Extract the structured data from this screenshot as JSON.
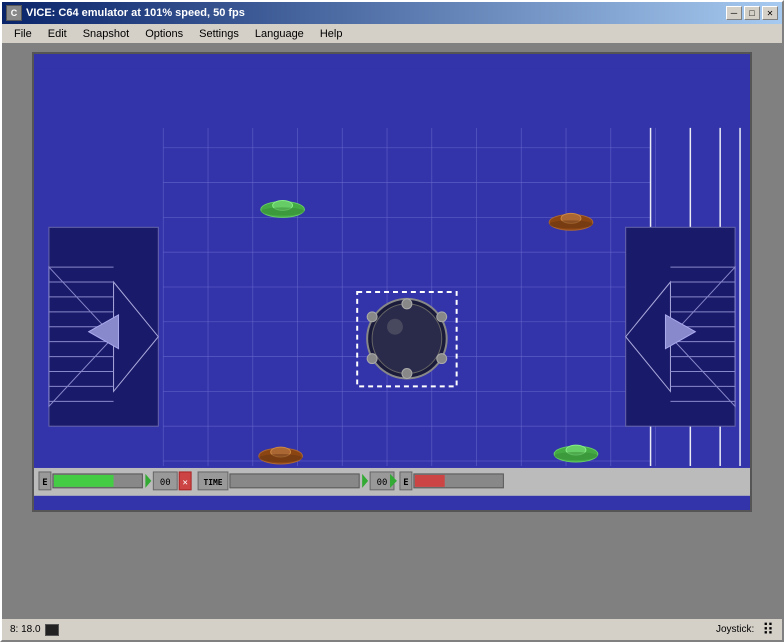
{
  "window": {
    "title": "VICE: C64 emulator at 101% speed, 50 fps",
    "icon": "C",
    "buttons": {
      "minimize": "─",
      "maximize": "□",
      "close": "✕"
    }
  },
  "menu": {
    "items": [
      "File",
      "Edit",
      "Snapshot",
      "Options",
      "Settings",
      "Language",
      "Help"
    ]
  },
  "game": {
    "background_color": "#3333aa",
    "hud": {
      "left_label": "E",
      "left_score": "00",
      "time_label": "TIME",
      "right_score": "00",
      "right_label": "E"
    }
  },
  "status_bar": {
    "position": "8: 18.0",
    "joystick_label": "Joystick:"
  }
}
